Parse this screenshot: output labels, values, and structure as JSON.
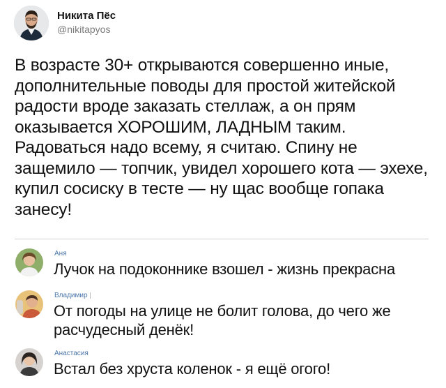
{
  "post": {
    "author_name": "Никита Пёс",
    "author_handle": "@nikitapyos",
    "text": "В возрасте 30+ открываются совершенно иные, дополнительные поводы для простой житейской радости вроде заказать стеллаж, а он прям оказывается ХОРОШИМ, ЛАДНЫМ таким. Радоваться надо всему, я считаю. Спину не защемило — топчик, увидел хорошего кота — эхехе, купил сосиску в тесте — ну щас вообще гопака занесу!"
  },
  "comments": [
    {
      "author": "Аня",
      "text": "Лучок на подоконнике взошел - жизнь прекрасна"
    },
    {
      "author": "Владимир",
      "text": "От погоды на улице не болит голова, до чего же расчудесный денёк!"
    },
    {
      "author": "Анастасия",
      "text": "Встал без хруста коленок - я ещё огого!"
    }
  ],
  "colors": {
    "comment_author": "#4a76a8",
    "handle": "#7a7a7a",
    "divider": "#cfcfcf"
  }
}
